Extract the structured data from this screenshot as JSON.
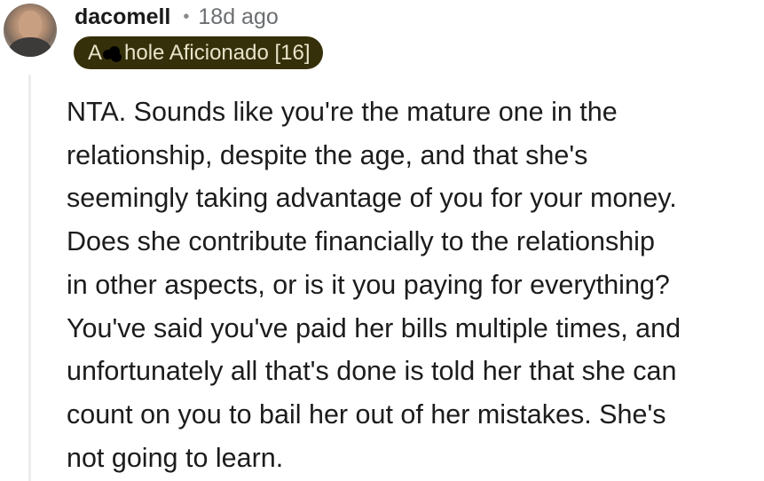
{
  "comment": {
    "author": {
      "username": "dacomell",
      "avatar": "user-avatar-photo"
    },
    "separator": "•",
    "timestamp": "18d ago",
    "flair": {
      "prefix": "A",
      "suffix": "hole Aficionado [16]",
      "redaction": "censor-blot",
      "background": "#35300a",
      "text_color": "#e8e3c9"
    },
    "body_lines": [
      "NTA. Sounds like you're the mature one in the",
      "relationship, despite the age, and that she's",
      "seemingly taking advantage of you for your money.",
      "Does she contribute financially to the relationship",
      "in other aspects, or is it you paying for everything?",
      "You've said you've paid her bills multiple times, and",
      "unfortunately all that's done is told her that she can",
      "count on you to bail her out of her mistakes. She's",
      "not going to learn."
    ],
    "thread_line_color": "#ececec"
  }
}
